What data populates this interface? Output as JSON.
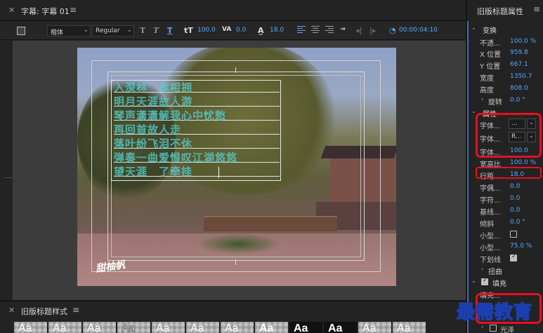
{
  "editor": {
    "title": "字幕: 字幕 01",
    "menu_icon": "≡",
    "toolbar": {
      "font_family": "楷体",
      "font_style": "Regular",
      "font_size": "100.0",
      "kerning": "0.0",
      "leading": "18.0",
      "tab_stops_icon": "tab-stops-icon",
      "timecode": "00:00:04:10"
    },
    "caption_lines": [
      "入深林　本相拥",
      "明月天涯故人游",
      "琴声潇潇解我心中忧愁",
      "再回首故人走",
      "落叶纷飞泪不休",
      "弹奏一曲爱恨叹江湖悠悠",
      "望天涯　了牵挂"
    ],
    "logo_text": "甜柚帆"
  },
  "styles": {
    "title": "旧版标题样式",
    "menu_icon": "≡",
    "swatches": [
      "Aa",
      "Aa",
      "Aa",
      "Aa",
      "Aa",
      "Aa",
      "Aa",
      "Aa",
      "Aa",
      "Aa",
      "Aa",
      "Aa"
    ]
  },
  "props": {
    "title": "旧版标题属性",
    "menu_icon": "≡",
    "transform_label": "变换",
    "opacity_label": "不透...",
    "opacity_value": "100.0 %",
    "x_label": "X 位置",
    "x_value": "959.8",
    "y_label": "Y 位置",
    "y_value": "667.1",
    "width_label": "宽度",
    "width_value": "1350.7",
    "height_label": "高度",
    "height_value": "808.0",
    "rotation_label": "旋转",
    "rotation_value": "0.0 °",
    "properties_label": "属性",
    "font_family_label": "字体...",
    "font_family_value": "...",
    "font_style_label": "字体...",
    "font_style_value": "R...",
    "font_size_label": "字体...",
    "font_size_value": "100.0",
    "aspect_label": "宽高比",
    "aspect_value": "100.0 %",
    "leading_label": "行距",
    "leading_value": "18.0",
    "kerning_label": "字偶...",
    "kerning_value": "0.0",
    "tracking_label": "字符...",
    "tracking_value": "0.0",
    "baseline_label": "基线...",
    "baseline_value": "0.0",
    "slant_label": "倾斜",
    "slant_value": "0.0 °",
    "smallcaps_label": "小型...",
    "smallcaps_size_label": "小型...",
    "smallcaps_size_value": "75.0 %",
    "underline_label": "下划线",
    "distort_label": "扭曲",
    "fill_label": "填充",
    "fill_type_label": "填充...",
    "sheen_label": "光泽"
  },
  "brand": "最需教育",
  "colors": {
    "accent_blue": "#58a6ff",
    "highlight_red": "#e8101e",
    "panel_bg": "#232323",
    "canvas_bg": "#3c3c3c"
  }
}
